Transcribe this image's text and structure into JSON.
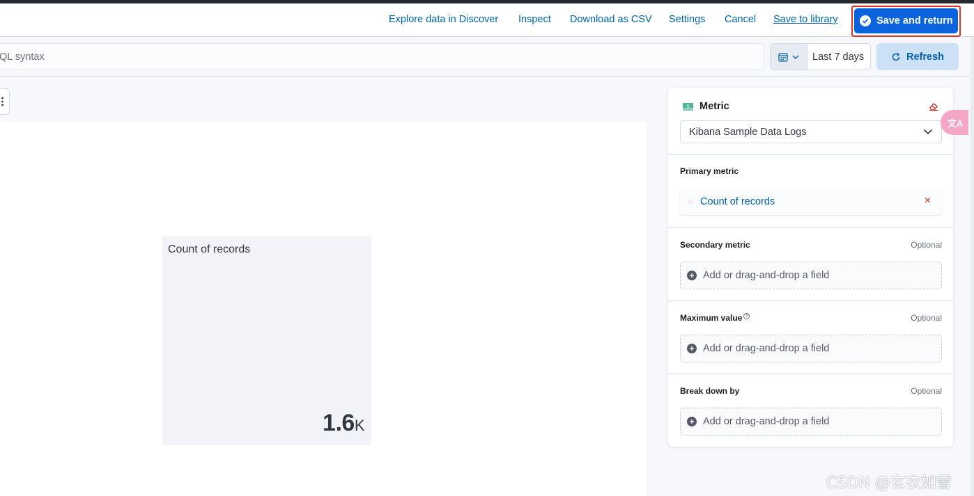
{
  "header": {
    "links": {
      "explore": "Explore data in Discover",
      "inspect": "Inspect",
      "download_csv": "Download as CSV",
      "settings": "Settings",
      "cancel": "Cancel",
      "save_to_library": "Save to library"
    },
    "save_and_return": "Save and return"
  },
  "query": {
    "placeholder_fragment": "QL syntax",
    "date_range": "Last 7 days",
    "refresh": "Refresh"
  },
  "visualization": {
    "metric_title": "Count of records",
    "metric_value": "1.6",
    "metric_unit": "K"
  },
  "panel": {
    "vis_type": "Metric",
    "data_view": "Kibana Sample Data Logs",
    "sections": {
      "primary": {
        "label": "Primary metric",
        "field": "Count of records",
        "remove": "×"
      },
      "secondary": {
        "label": "Secondary metric",
        "optional": "Optional",
        "drop_text": "Add or drag-and-drop a field"
      },
      "maximum": {
        "label": "Maximum value",
        "optional": "Optional",
        "drop_text": "Add or drag-and-drop a field"
      },
      "breakdown": {
        "label": "Break down by",
        "optional": "Optional",
        "drop_text": "Add or drag-and-drop a field"
      }
    }
  },
  "overlay": {
    "translate_label": "文A",
    "watermark": "CSDN @玄衣如雪"
  },
  "icons": {
    "check": "check-circle-icon",
    "calendar": "calendar-icon",
    "refresh": "refresh-icon",
    "menu": "kebab-menu-icon",
    "metric": "metric-vis-icon",
    "eraser": "eraser-icon",
    "chevron": "chevron-down-icon",
    "plus": "plus-circle-icon",
    "info": "info-icon"
  },
  "colors": {
    "accent": "#0b64dd",
    "link": "#0061a6",
    "highlight_outline": "#e0332a",
    "danger": "#bd271e"
  }
}
